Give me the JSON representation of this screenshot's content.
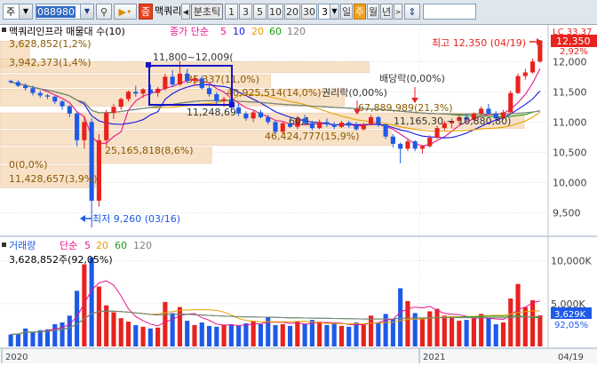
{
  "toolbar": {
    "market_select": "주",
    "code_value": "088980",
    "find_icon": "magnifier-icon",
    "sound_icon": "speaker-icon",
    "stock_badge": "종",
    "stock_name": "맥쿼리",
    "period_label": "분초틱",
    "intervals": [
      "1",
      "3",
      "5",
      "10",
      "20",
      "30"
    ],
    "interval_value": "3",
    "periods": [
      "일",
      "주",
      "월",
      "년"
    ],
    "selected_period": "주"
  },
  "legend": {
    "title": "맥쿼리인프라 매물대 수(10)",
    "ma_label": "종가 단순",
    "ma_periods": [
      "5",
      "10",
      "20",
      "60",
      "120"
    ],
    "ma_colors": [
      "#e8148c",
      "#1414e8",
      "#e8a000",
      "#14a014",
      "#808080"
    ],
    "volume_label": "거래량",
    "volume_ma_label": "단순",
    "volume_ma_periods": [
      "5",
      "20",
      "60",
      "120"
    ]
  },
  "annotations": {
    "top_left_1": "3,628,852(1,2%)",
    "top_left_2": "3,942,373(1,4%)",
    "box_top": "11,800~12,009(",
    "box_label": "35,337(11,0%)",
    "box_bottom": "11,248,69",
    "mid_label": "40,925,514(14,0%)",
    "rights_label": "권리락(0,00%)",
    "dividend_label": "배당락(0,00%)",
    "right_box": "67,889,989(21,3%)",
    "right_range": "11,165,30 ~ 10,880,80)",
    "left_range": "60,1",
    "left_vol": "25,165,818(8,6%)",
    "mid_vol": "46,424,777(15,9%)",
    "zero_label": "0(0,0%)",
    "low_vol": "11,428,657(3,9%)",
    "high_label": "최고 12,350 (04/19)",
    "low_label": "최저 9,260 (03/16)",
    "current_price": "12,350",
    "current_pct": "2,92%",
    "current_top": "LC 33,37",
    "volume_info": "3,628,852주(92,05%)",
    "current_volume": "3,629K",
    "current_volume_pct": "92,05%"
  },
  "price_axis": [
    "12,000",
    "11,500",
    "11,000",
    "10,500",
    "10,000",
    "9,500"
  ],
  "volume_axis": [
    "10,000K",
    "5,000K"
  ],
  "time_axis": [
    "2020",
    "2021",
    "04/19"
  ],
  "colors": {
    "up": "#e8221e",
    "down": "#1e5ae8",
    "volume_profile": "#f6dcbe",
    "volume_profile_border": "#e9b98d",
    "box": "#1414c8",
    "axis_text": "#404040"
  },
  "chart_data": {
    "type": "candlestick",
    "price_ylim": [
      9200,
      12400
    ],
    "volume_ylim": [
      0,
      11000000
    ],
    "candles": [
      [
        11680,
        11700,
        11640,
        11660,
        1400000
      ],
      [
        11660,
        11690,
        11580,
        11600,
        1500000
      ],
      [
        11600,
        11640,
        11520,
        11560,
        2100000
      ],
      [
        11560,
        11600,
        11440,
        11480,
        1700000
      ],
      [
        11480,
        11520,
        11400,
        11440,
        1900000
      ],
      [
        11440,
        11460,
        11380,
        11420,
        2000000
      ],
      [
        11420,
        11430,
        11300,
        11340,
        2600000
      ],
      [
        11340,
        11360,
        11200,
        11260,
        2800000
      ],
      [
        11260,
        11280,
        11080,
        11140,
        3600000
      ],
      [
        11140,
        11160,
        10600,
        10700,
        6500000
      ],
      [
        10700,
        11100,
        10560,
        11000,
        9600000
      ],
      [
        11000,
        11060,
        9260,
        9700,
        10400000
      ],
      [
        9700,
        10800,
        9600,
        10700,
        7000000
      ],
      [
        10700,
        11200,
        10600,
        11150,
        4800000
      ],
      [
        11150,
        11300,
        11050,
        11250,
        4000000
      ],
      [
        11250,
        11400,
        11200,
        11380,
        3300000
      ],
      [
        11380,
        11520,
        11340,
        11500,
        2900000
      ],
      [
        11500,
        11600,
        11420,
        11470,
        2500000
      ],
      [
        11470,
        11560,
        11400,
        11540,
        2300000
      ],
      [
        11540,
        11620,
        11450,
        11480,
        2100000
      ],
      [
        11480,
        11580,
        11420,
        11550,
        2200000
      ],
      [
        11550,
        11800,
        11520,
        11750,
        5200000
      ],
      [
        11750,
        11860,
        11580,
        11620,
        3900000
      ],
      [
        11620,
        12009,
        11600,
        11800,
        4600000
      ],
      [
        11800,
        11880,
        11640,
        11680,
        3000000
      ],
      [
        11680,
        11760,
        11600,
        11720,
        2500000
      ],
      [
        11720,
        11760,
        11540,
        11560,
        2800000
      ],
      [
        11560,
        11600,
        11420,
        11460,
        2400000
      ],
      [
        11460,
        11500,
        11300,
        11350,
        2300000
      ],
      [
        11350,
        11420,
        11250,
        11380,
        2500000
      ],
      [
        11380,
        11400,
        11200,
        11240,
        2600000
      ],
      [
        11240,
        11300,
        11100,
        11140,
        2400000
      ],
      [
        11140,
        11180,
        11020,
        11060,
        2700000
      ],
      [
        11060,
        11200,
        11000,
        11160,
        3000000
      ],
      [
        11160,
        11200,
        11060,
        11080,
        2600000
      ],
      [
        11080,
        11120,
        10960,
        11000,
        3400000
      ],
      [
        11000,
        11020,
        10800,
        10840,
        2500000
      ],
      [
        10840,
        11000,
        10800,
        10980,
        2600000
      ],
      [
        10980,
        11050,
        10900,
        10920,
        2400000
      ],
      [
        10920,
        11100,
        10880,
        11060,
        2900000
      ],
      [
        11060,
        11120,
        10960,
        10980,
        2600000
      ],
      [
        10980,
        11020,
        10860,
        10900,
        3100000
      ],
      [
        10900,
        11040,
        10880,
        11000,
        2900000
      ],
      [
        11000,
        11060,
        10920,
        10960,
        2500000
      ],
      [
        10960,
        11000,
        10880,
        10920,
        2700000
      ],
      [
        10920,
        11020,
        10900,
        10990,
        2400000
      ],
      [
        10990,
        11020,
        10900,
        10940,
        2300000
      ],
      [
        10940,
        11000,
        10860,
        10880,
        2800000
      ],
      [
        10880,
        10980,
        10860,
        10960,
        2500000
      ],
      [
        10960,
        11120,
        10940,
        11080,
        3600000
      ],
      [
        11080,
        11100,
        10920,
        10960,
        2700000
      ],
      [
        10960,
        10980,
        10720,
        10760,
        3800000
      ],
      [
        10760,
        10800,
        10580,
        10640,
        3200000
      ],
      [
        10640,
        10660,
        10320,
        10560,
        6800000
      ],
      [
        10560,
        10720,
        10520,
        10680,
        5300000
      ],
      [
        10680,
        10700,
        10520,
        10560,
        3900000
      ],
      [
        10560,
        10620,
        10480,
        10600,
        3300000
      ],
      [
        10600,
        10780,
        10580,
        10740,
        4100000
      ],
      [
        10740,
        10940,
        10720,
        10900,
        4400000
      ],
      [
        10900,
        11020,
        10860,
        10980,
        3600000
      ],
      [
        10980,
        11060,
        10900,
        11020,
        3500000
      ],
      [
        11020,
        11120,
        10980,
        11080,
        3000000
      ],
      [
        11080,
        11140,
        11000,
        11040,
        3100000
      ],
      [
        11040,
        11160,
        11020,
        11140,
        3300000
      ],
      [
        11140,
        11260,
        11100,
        11220,
        3800000
      ],
      [
        11220,
        11300,
        11120,
        11140,
        3300000
      ],
      [
        11140,
        11180,
        11020,
        11060,
        2600000
      ],
      [
        11060,
        11200,
        11040,
        11160,
        2800000
      ],
      [
        11160,
        11520,
        11140,
        11480,
        5600000
      ],
      [
        11480,
        11800,
        11460,
        11760,
        7300000
      ],
      [
        11760,
        11880,
        11700,
        11820,
        4600000
      ],
      [
        11820,
        12050,
        11800,
        12000,
        5400000
      ],
      [
        12000,
        12350,
        11980,
        12350,
        3628852
      ]
    ],
    "volume_profile": [
      {
        "from": 11800,
        "to": 12009,
        "pct": 15
      },
      {
        "from": 11560,
        "to": 11800,
        "pct": 11.0
      },
      {
        "from": 11248,
        "to": 11560,
        "pct": 14.0
      },
      {
        "from": 10880,
        "to": 11165,
        "pct": 21.3
      },
      {
        "from": 10600,
        "to": 10880,
        "pct": 15.9
      },
      {
        "from": 10300,
        "to": 10600,
        "pct": 8.6
      },
      {
        "from": 9900,
        "to": 10300,
        "pct": 3.9
      },
      {
        "from": 9260,
        "to": 9900,
        "pct": 0.0
      },
      {
        "from": 12009,
        "to": 12350,
        "pct": 1.2
      },
      {
        "from": 11900,
        "to": 12050,
        "pct": 1.4
      }
    ]
  }
}
